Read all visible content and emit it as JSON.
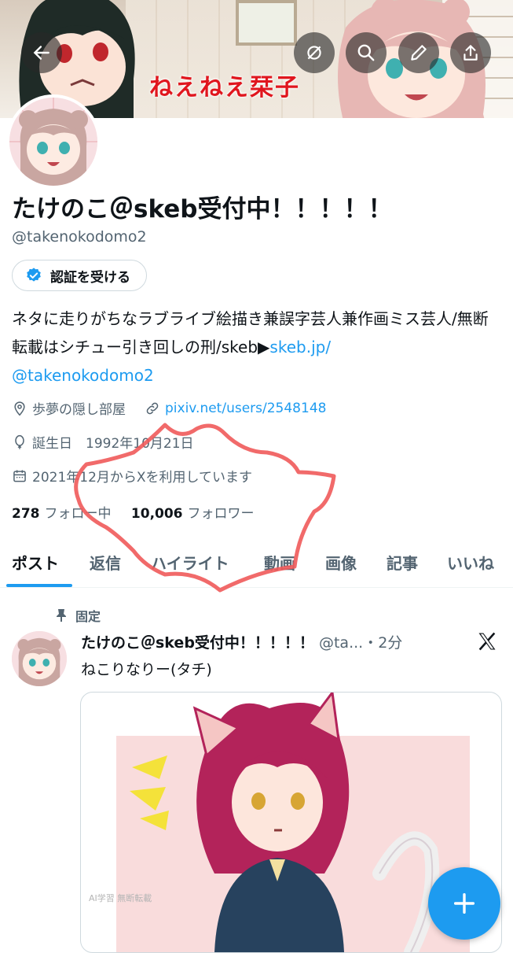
{
  "banner": {
    "title": "ねえねえ栞子"
  },
  "top_actions": {
    "back": "arrow-left-icon",
    "mute": "eye-slash-icon",
    "search": "search-icon",
    "edit": "pen-icon",
    "share": "share-icon"
  },
  "profile": {
    "display_name": "たけのこ＠skeb受付中！！！！！",
    "handle": "@takenokodomo2",
    "verify_label": "認証を受ける",
    "bio_text": "ネタに走りがちなラブライブ絵描き兼誤字芸人兼作画ミス芸人/無断転載はシチュー引き回しの刑/skeb▶",
    "bio_link": "skeb.jp/",
    "bio_mention": "@takenokodomo2",
    "location": "歩夢の隠し部屋",
    "website": "pixiv.net/users/2548148",
    "birthday": "誕生日　1992年10月21日",
    "joined": "2021年12月からXを利用しています",
    "following_count": "278",
    "following_label": "フォロー中",
    "followers_count": "10,006",
    "followers_label": "フォロワー"
  },
  "tabs": [
    "ポスト",
    "返信",
    "ハイライト",
    "動画",
    "画像",
    "記事",
    "いいね"
  ],
  "active_tab": "ポスト",
  "post": {
    "pinned_label": "固定",
    "author": "たけのこ＠skeb受付中！！！！！",
    "handle_time": "@ta...・2分",
    "text": "ねこりなりー(タチ)",
    "watermark": "AI学習 無断転載"
  },
  "colors": {
    "accent": "#1d9bf0",
    "banner_title": "#e0161e",
    "annotation": "#ef5a5a"
  }
}
